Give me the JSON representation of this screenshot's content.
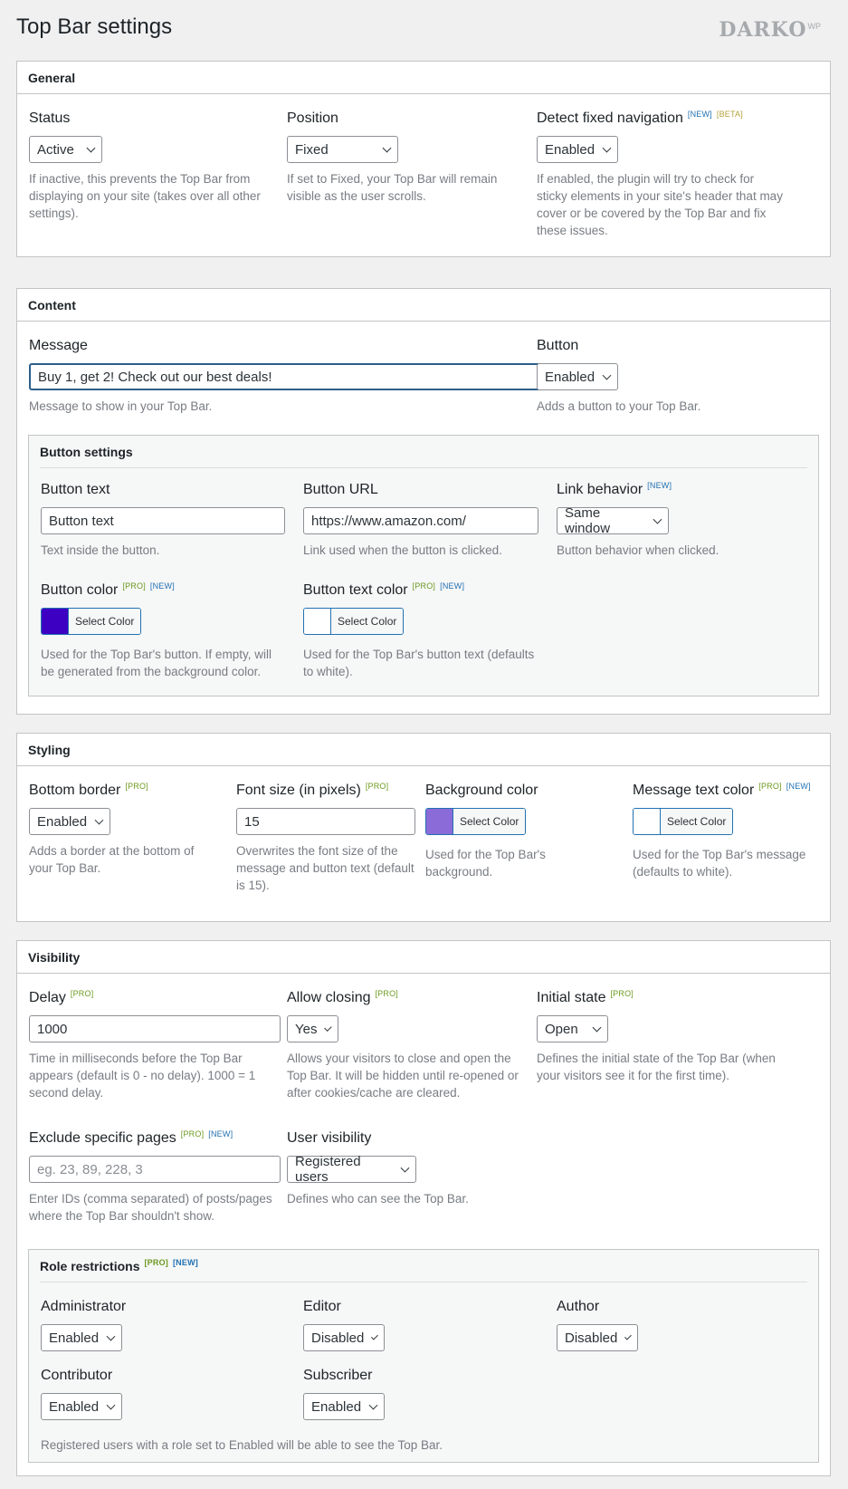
{
  "page": {
    "title": "Top Bar settings",
    "logo_text": "DARKO",
    "logo_sup": "WP"
  },
  "badges": {
    "new": "[NEW]",
    "pro": "[PRO]",
    "beta": "[BETA]"
  },
  "general": {
    "title": "General",
    "status": {
      "label": "Status",
      "value": "Active",
      "desc": "If inactive, this prevents the Top Bar from displaying on your site (takes over all other settings)."
    },
    "position": {
      "label": "Position",
      "value": "Fixed",
      "desc": "If set to Fixed, your Top Bar will remain visible as the user scrolls."
    },
    "detect": {
      "label": "Detect fixed navigation",
      "value": "Enabled",
      "desc": "If enabled, the plugin will try to check for sticky elements in your site's header that may cover or be covered by the Top Bar and fix these issues."
    }
  },
  "content": {
    "title": "Content",
    "message": {
      "label": "Message",
      "value": "Buy 1, get 2! Check out our best deals!",
      "desc": "Message to show in your Top Bar."
    },
    "button": {
      "label": "Button",
      "value": "Enabled",
      "desc": "Adds a button to your Top Bar."
    },
    "button_settings": {
      "title": "Button settings",
      "text": {
        "label": "Button text",
        "value": "Button text",
        "desc": "Text inside the button."
      },
      "url": {
        "label": "Button URL",
        "value": "https://www.amazon.com/",
        "desc": "Link used when the button is clicked."
      },
      "link_behavior": {
        "label": "Link behavior",
        "value": "Same window",
        "desc": "Button behavior when clicked."
      },
      "color": {
        "label": "Button color",
        "button": "Select Color",
        "swatch": "#3d00c2",
        "desc": "Used for the Top Bar's button. If empty, will be generated from the background color."
      },
      "text_color": {
        "label": "Button text color",
        "button": "Select Color",
        "swatch": "#ffffff",
        "desc": "Used for the Top Bar's button text (defaults to white)."
      }
    }
  },
  "styling": {
    "title": "Styling",
    "bottom_border": {
      "label": "Bottom border",
      "value": "Enabled",
      "desc": "Adds a border at the bottom of your Top Bar."
    },
    "font_size": {
      "label": "Font size (in pixels)",
      "value": "15",
      "desc": "Overwrites the font size of the message and button text (default is 15)."
    },
    "background_color": {
      "label": "Background color",
      "button": "Select Color",
      "swatch": "#8a6bd8",
      "desc": "Used for the Top Bar's background."
    },
    "message_text_color": {
      "label": "Message text color",
      "button": "Select Color",
      "swatch": "#ffffff",
      "desc": "Used for the Top Bar's message (defaults to white)."
    }
  },
  "visibility": {
    "title": "Visibility",
    "delay": {
      "label": "Delay",
      "value": "1000",
      "desc": "Time in milliseconds before the Top Bar appears (default is 0 - no delay). 1000 = 1 second delay."
    },
    "allow_closing": {
      "label": "Allow closing",
      "value": "Yes",
      "desc": "Allows your visitors to close and open the Top Bar. It will be hidden until re-opened or after cookies/cache are cleared."
    },
    "initial_state": {
      "label": "Initial state",
      "value": "Open",
      "desc": "Defines the initial state of the Top Bar (when your visitors see it for the first time)."
    },
    "exclude_pages": {
      "label": "Exclude specific pages",
      "placeholder": "eg. 23, 89, 228, 3",
      "desc": "Enter IDs (comma separated) of posts/pages where the Top Bar shouldn't show."
    },
    "user_visibility": {
      "label": "User visibility",
      "value": "Registered users",
      "desc": "Defines who can see the Top Bar."
    },
    "role_restrictions": {
      "title": "Role restrictions",
      "administrator": {
        "label": "Administrator",
        "value": "Enabled"
      },
      "editor": {
        "label": "Editor",
        "value": "Disabled"
      },
      "author": {
        "label": "Author",
        "value": "Disabled"
      },
      "contributor": {
        "label": "Contributor",
        "value": "Enabled"
      },
      "subscriber": {
        "label": "Subscriber",
        "value": "Enabled"
      },
      "desc": "Registered users with a role set to Enabled will be able to see the Top Bar."
    }
  }
}
